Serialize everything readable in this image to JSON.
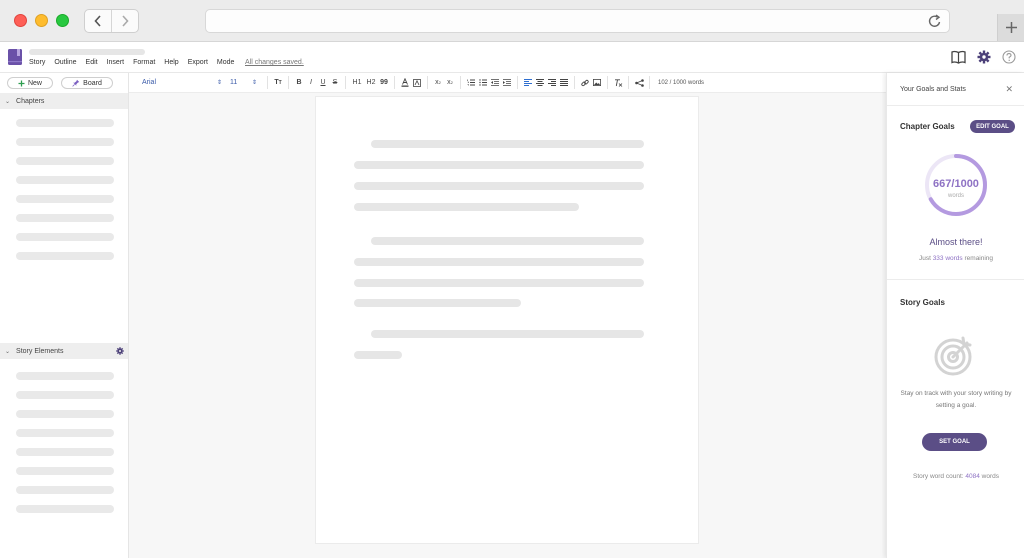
{
  "browser": {
    "back_icon": "chevron-left-icon",
    "forward_icon": "chevron-right-icon",
    "reload_icon": "reload-icon",
    "newtab_icon": "plus-icon"
  },
  "header": {
    "menu": [
      "Story",
      "Outline",
      "Edit",
      "Insert",
      "Format",
      "Help",
      "Export",
      "Mode"
    ],
    "save_status": "All changes saved.",
    "accent_color": "#5b4e86"
  },
  "sidebar": {
    "new_label": "New",
    "board_label": "Board",
    "chapters_label": "Chapters",
    "story_elements_label": "Story Elements"
  },
  "toolbar": {
    "font": "Arial",
    "size": "11",
    "bold": "B",
    "italic": "I",
    "underline": "U",
    "strike": "S",
    "h1": "H1",
    "h2": "H2",
    "quote": "99",
    "sub": "x2",
    "sup": "x2",
    "word_count": "102 / 1000 words"
  },
  "panel": {
    "title": "Your Goals and Stats",
    "chapter_goals_title": "Chapter Goals",
    "edit_goal_label": "EDIT GOAL",
    "progress_value": "667/1000",
    "progress_unit": "words",
    "progress_fraction": 0.667,
    "almost_text": "Almost there!",
    "remaining_prefix": "Just",
    "remaining_words": "333 words",
    "remaining_suffix": "remaining",
    "story_goals_title": "Story Goals",
    "track_text": "Stay on track with your story writing by setting a goal.",
    "set_goal_label": "SET GOAL",
    "story_count_prefix": "Story word count:",
    "story_count_value": "4084",
    "story_count_suffix": "words"
  }
}
